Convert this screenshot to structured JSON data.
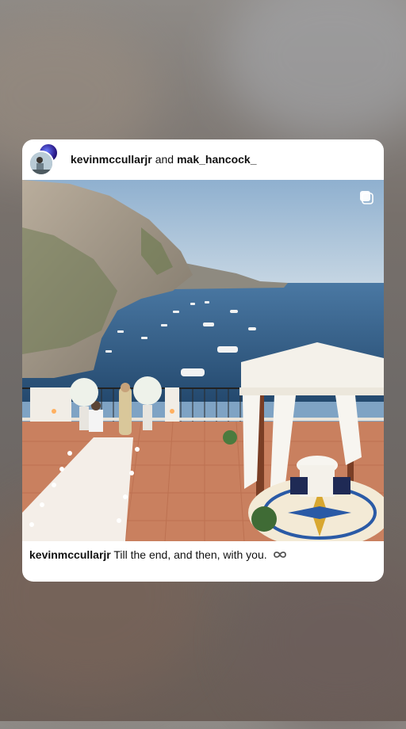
{
  "post": {
    "author": "kevinmccullarjr",
    "conjunction": "and",
    "coauthor": "mak_hancock_",
    "caption_user": "kevinmccullarjr",
    "caption_text": "Till the end, and then, with you.",
    "caption_emoji": "infinity-icon"
  },
  "colors": {
    "card": "#ffffff",
    "sea": "#2f5a84",
    "sky": "#b8cde0",
    "terrace": "#c77a5b",
    "gazebo": "#f4f1ea"
  }
}
